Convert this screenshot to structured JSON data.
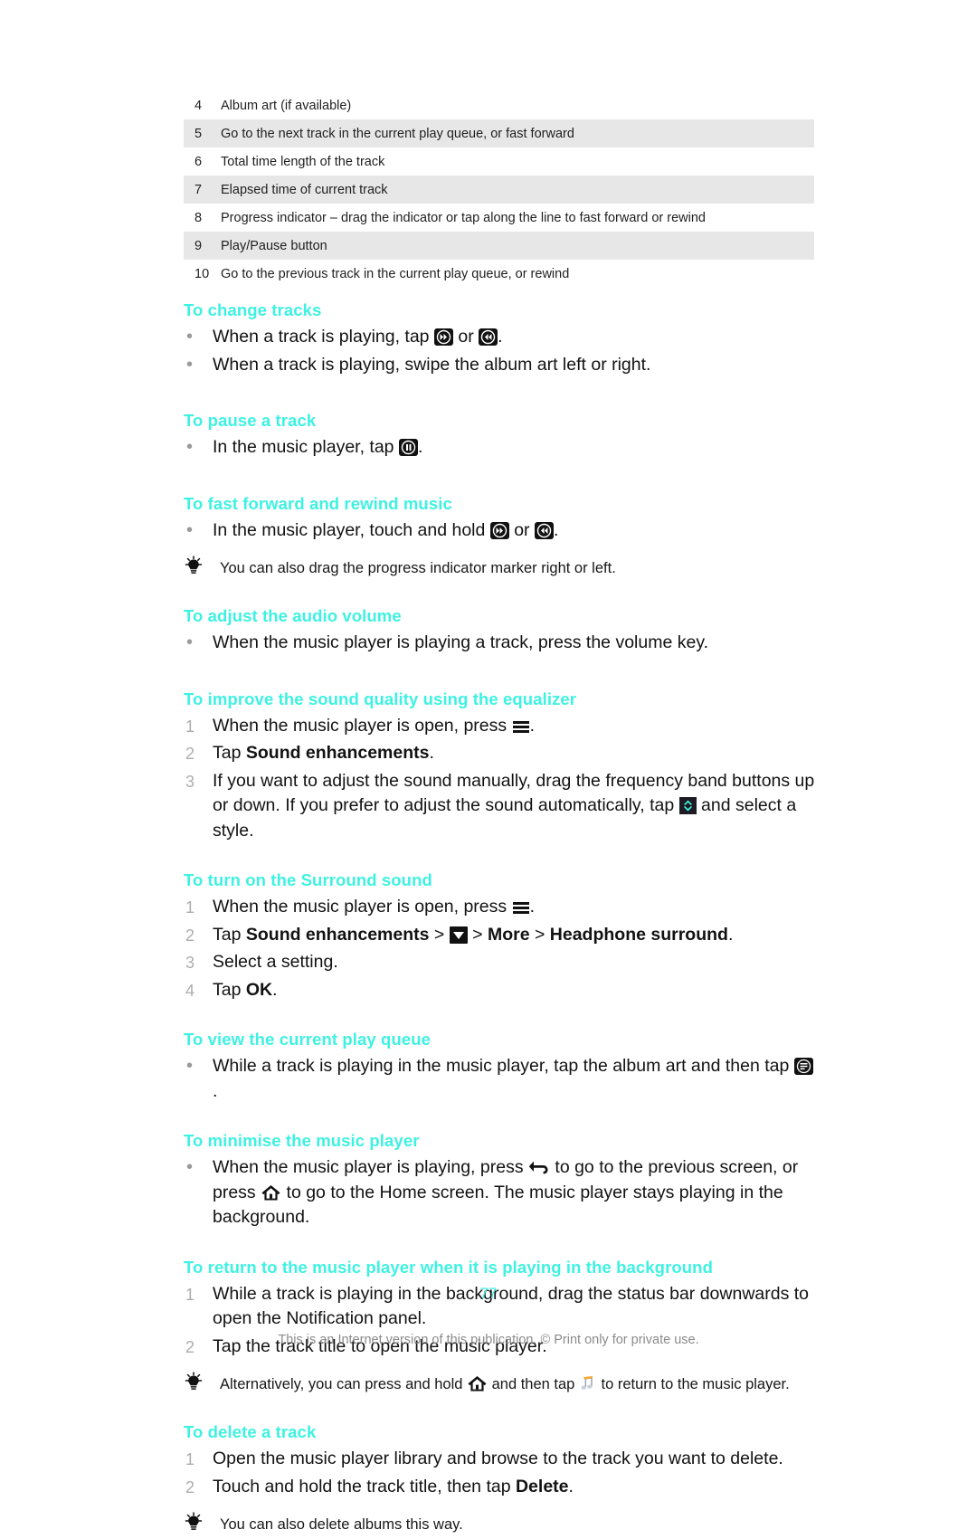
{
  "page": {
    "number": "77",
    "footnote": "This is an Internet version of this publication. © Print only for private use.",
    "accent_color": "#3df2e2",
    "table_stripe_color": "#e7e7e7"
  },
  "reference_table": {
    "rows": [
      {
        "num": "4",
        "desc": "Album art (if available)"
      },
      {
        "num": "5",
        "desc": "Go to the next track in the current play queue, or fast forward"
      },
      {
        "num": "6",
        "desc": "Total time length of the track"
      },
      {
        "num": "7",
        "desc": "Elapsed time of current track"
      },
      {
        "num": "8",
        "desc": "Progress indicator – drag the indicator or tap along the line to fast forward or rewind"
      },
      {
        "num": "9",
        "desc": "Play/Pause button"
      },
      {
        "num": "10",
        "desc": "Go to the previous track in the current play queue, or rewind"
      }
    ]
  },
  "sections": {
    "change_tracks": {
      "heading": "To change tracks",
      "b1_pre": "When a track is playing, tap ",
      "b1_mid": " or ",
      "b1_post": ".",
      "b2": "When a track is playing, swipe the album art left or right."
    },
    "pause_track": {
      "heading": "To pause a track",
      "b1_pre": "In the music player, tap ",
      "b1_post": "."
    },
    "fast_forward": {
      "heading": "To fast forward and rewind music",
      "b1_pre": "In the music player, touch and hold ",
      "b1_mid": " or ",
      "b1_post": ".",
      "tip": "You can also drag the progress indicator marker right or left."
    },
    "audio_volume": {
      "heading": "To adjust the audio volume",
      "b1": "When the music player is playing a track, press the volume key."
    },
    "equalizer": {
      "heading": "To improve the sound quality using the equalizer",
      "s1_pre": "When the music player is open, press ",
      "s1_post": ".",
      "s2_pre": "Tap ",
      "s2_bold": "Sound enhancements",
      "s2_post": ".",
      "s3_pre": "If you want to adjust the sound manually, drag the frequency band buttons up or down. If you prefer to adjust the sound automatically, tap ",
      "s3_post": " and select a style."
    },
    "surround": {
      "heading": "To turn on the Surround sound",
      "s1_pre": "When the music player is open, press ",
      "s1_post": ".",
      "s2_pre": "Tap ",
      "s2_bold1": "Sound enhancements",
      "s2_sep1": " > ",
      "s2_sep2": " > ",
      "s2_bold2": "More",
      "s2_sep3": " > ",
      "s2_bold3": "Headphone surround",
      "s2_post": ".",
      "s3": "Select a setting.",
      "s4_pre": "Tap ",
      "s4_bold": "OK",
      "s4_post": "."
    },
    "play_queue": {
      "heading": "To view the current play queue",
      "b1_pre": "While a track is playing in the music player, tap the album art and then tap ",
      "b1_post": "."
    },
    "minimise": {
      "heading": "To minimise the music player",
      "b1_pre": "When the music player is playing, press ",
      "b1_mid": " to go to the previous screen, or press ",
      "b1_post": " to go to the Home screen. The music player stays playing in the background."
    },
    "return_background": {
      "heading": "To return to the music player when it is playing in the background",
      "s1": "While a track is playing in the background, drag the status bar downwards to open the Notification panel.",
      "s2": "Tap the track title to open the music player.",
      "tip_pre": "Alternatively, you can press and hold ",
      "tip_mid": " and then tap ",
      "tip_post": " to return to the music player."
    },
    "delete_track": {
      "heading": "To delete a track",
      "s1": "Open the music player library and browse to the track you want to delete.",
      "s2_pre": "Touch and hold the track title, then tap ",
      "s2_bold": "Delete",
      "s2_post": ".",
      "tip": "You can also delete albums this way."
    }
  },
  "icons": {
    "next_track": "next-track-icon",
    "previous_track": "previous-track-icon",
    "pause": "pause-icon",
    "menu": "menu-icon",
    "updown": "up-down-chevron-icon",
    "dropdown": "dropdown-triangle-icon",
    "play_queue": "play-queue-icon",
    "back": "back-arrow-icon",
    "home": "home-icon",
    "music_note": "music-note-icon",
    "bulb": "light-bulb-icon"
  },
  "markers": {
    "bullet": "•"
  }
}
